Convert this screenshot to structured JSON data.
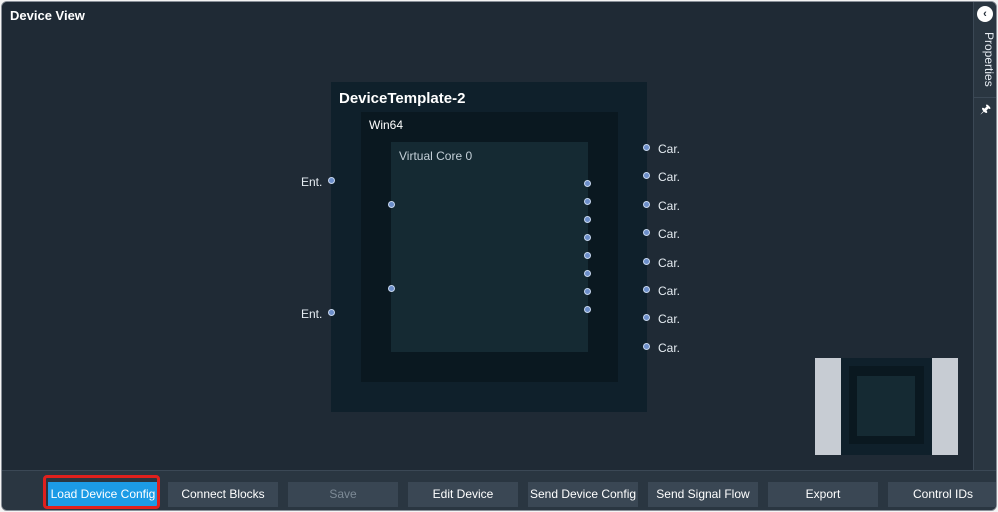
{
  "window": {
    "title": "Device View"
  },
  "side_panel": {
    "label": "Properties",
    "collapse_icon": "chevron-left-icon",
    "pin_icon": "pin-icon"
  },
  "device": {
    "name": "DeviceTemplate-2",
    "platform": "Win64",
    "core": "Virtual Core 0",
    "entry_ports": [
      "Ent.",
      "Ent."
    ],
    "carrier_ports": [
      "Car.",
      "Car.",
      "Car.",
      "Car.",
      "Car.",
      "Car.",
      "Car.",
      "Car."
    ]
  },
  "toolbar": {
    "buttons": [
      {
        "label": "Load Device Config",
        "state": "primary"
      },
      {
        "label": "Connect Blocks",
        "state": "normal"
      },
      {
        "label": "Save",
        "state": "disabled"
      },
      {
        "label": "Edit Device",
        "state": "normal"
      },
      {
        "label": "Send Device Config",
        "state": "normal"
      },
      {
        "label": "Send Signal Flow",
        "state": "normal"
      },
      {
        "label": "Export",
        "state": "normal"
      },
      {
        "label": "Control IDs",
        "state": "normal"
      }
    ]
  },
  "colors": {
    "background": "#1f2a35",
    "accent": "#1c9be6",
    "highlight": "#e0201d"
  }
}
